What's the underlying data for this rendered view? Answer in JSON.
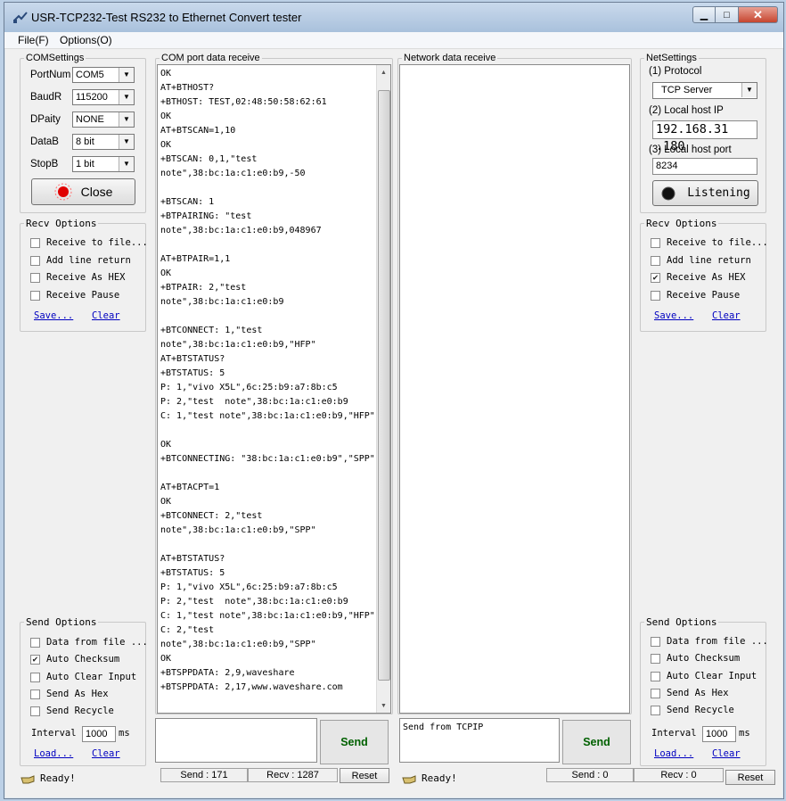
{
  "window": {
    "title": "USR-TCP232-Test  RS232 to Ethernet Convert tester",
    "minimize": "▁",
    "maximize": "□",
    "close": "✕"
  },
  "menu": [
    "File(F)",
    "Options(O)"
  ],
  "com_settings": {
    "legend": "COMSettings",
    "port_label": "PortNum",
    "port_value": "COM5",
    "baud_label": "BaudR",
    "baud_value": "115200",
    "parity_label": "DPaity",
    "parity_value": "NONE",
    "databits_label": "DataB",
    "databits_value": "8 bit",
    "stopbits_label": "StopB",
    "stopbits_value": "1 bit",
    "button_label": "Close",
    "led_color": "#e00000"
  },
  "left_recv": {
    "legend": "Recv Options",
    "options": [
      {
        "label": "Receive to file...",
        "checked": false
      },
      {
        "label": "Add line return",
        "checked": false
      },
      {
        "label": "Receive As HEX",
        "checked": false
      },
      {
        "label": "Receive Pause",
        "checked": false
      }
    ],
    "save_link": "Save...",
    "clear_link": "Clear"
  },
  "left_send": {
    "legend": "Send Options",
    "options": [
      {
        "label": "Data from file ...",
        "checked": false
      },
      {
        "label": "Auto Checksum",
        "checked": true
      },
      {
        "label": "Auto Clear Input",
        "checked": false
      },
      {
        "label": "Send As Hex",
        "checked": false
      },
      {
        "label": "Send Recycle",
        "checked": false
      }
    ],
    "interval_label": "Interval",
    "interval_value": "1000",
    "interval_unit": "ms",
    "load_link": "Load...",
    "clear_link": "Clear"
  },
  "com_receive": {
    "legend": "COM port data receive",
    "lines": [
      "OK",
      "AT+BTHOST?",
      "+BTHOST: TEST,02:48:50:58:62:61",
      "OK",
      "AT+BTSCAN=1,10",
      "OK",
      "+BTSCAN: 0,1,\"test",
      "note\",38:bc:1a:c1:e0:b9,-50",
      "",
      "+BTSCAN: 1",
      "+BTPAIRING: \"test",
      "note\",38:bc:1a:c1:e0:b9,048967",
      "",
      "AT+BTPAIR=1,1",
      "OK",
      "+BTPAIR: 2,\"test",
      "note\",38:bc:1a:c1:e0:b9",
      "",
      "+BTCONNECT: 1,\"test",
      "note\",38:bc:1a:c1:e0:b9,\"HFP\"",
      "AT+BTSTATUS?",
      "+BTSTATUS: 5",
      "P: 1,\"vivo X5L\",6c:25:b9:a7:8b:c5",
      "P: 2,\"test  note\",38:bc:1a:c1:e0:b9",
      "C: 1,\"test note\",38:bc:1a:c1:e0:b9,\"HFP\"",
      "",
      "OK",
      "+BTCONNECTING: \"38:bc:1a:c1:e0:b9\",\"SPP\"",
      "",
      "AT+BTACPT=1",
      "OK",
      "+BTCONNECT: 2,\"test",
      "note\",38:bc:1a:c1:e0:b9,\"SPP\"",
      "",
      "AT+BTSTATUS?",
      "+BTSTATUS: 5",
      "P: 1,\"vivo X5L\",6c:25:b9:a7:8b:c5",
      "P: 2,\"test  note\",38:bc:1a:c1:e0:b9",
      "C: 1,\"test note\",38:bc:1a:c1:e0:b9,\"HFP\"",
      "C: 2,\"test",
      "note\",38:bc:1a:c1:e0:b9,\"SPP\"",
      "OK",
      "+BTSPPDATA: 2,9,waveshare",
      "+BTSPPDATA: 2,17,www.waveshare.com"
    ],
    "send_text": "",
    "send_button": "Send"
  },
  "net_receive": {
    "legend": "Network data receive",
    "send_text": "Send from TCPIP",
    "send_button": "Send"
  },
  "net_settings": {
    "legend": "NetSettings",
    "protocol_label": "(1) Protocol",
    "protocol_value": "TCP Server",
    "ip_label": "(2) Local host IP",
    "ip_value": "192.168.31 .180",
    "port_label": "(3) Local host port",
    "port_value": "8234",
    "button_label": "Listening"
  },
  "right_recv": {
    "legend": "Recv Options",
    "options": [
      {
        "label": "Receive to file...",
        "checked": false
      },
      {
        "label": "Add line return",
        "checked": false
      },
      {
        "label": "Receive As HEX",
        "checked": true
      },
      {
        "label": "Receive Pause",
        "checked": false
      }
    ],
    "save_link": "Save...",
    "clear_link": "Clear"
  },
  "right_send": {
    "legend": "Send Options",
    "options": [
      {
        "label": "Data from file ...",
        "checked": false
      },
      {
        "label": "Auto Checksum",
        "checked": false
      },
      {
        "label": "Auto Clear Input",
        "checked": false
      },
      {
        "label": "Send As Hex",
        "checked": false
      },
      {
        "label": "Send Recycle",
        "checked": false
      }
    ],
    "interval_label": "Interval",
    "interval_value": "1000",
    "interval_unit": "ms",
    "load_link": "Load...",
    "clear_link": "Clear"
  },
  "status_left": {
    "ready": "Ready!",
    "send": "Send : 171",
    "recv": "Recv : 1287",
    "reset": "Reset"
  },
  "status_right": {
    "ready": "Ready!",
    "send": "Send : 0",
    "recv": "Recv : 0",
    "reset": "Reset"
  }
}
